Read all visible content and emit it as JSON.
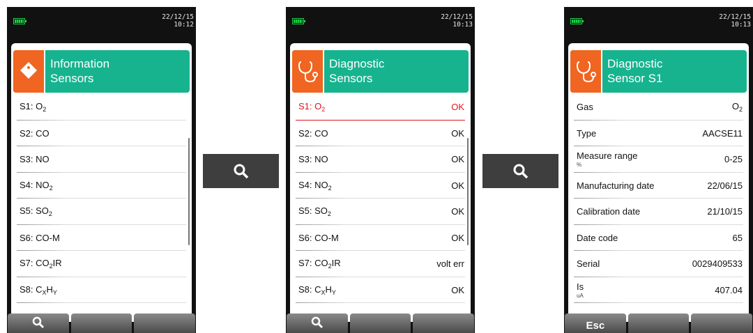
{
  "screens": [
    {
      "time_date": "22/12/15",
      "time_clock": "10:12",
      "header_line1": "Information",
      "header_line2": "Sensors",
      "header_icon": "tag-icon",
      "rows": [
        {
          "label": "S1: O<sub>2</sub>",
          "value": ""
        },
        {
          "label": "S2: CO",
          "value": ""
        },
        {
          "label": "S3: NO",
          "value": ""
        },
        {
          "label": "S4: NO<sub>2</sub>",
          "value": ""
        },
        {
          "label": "S5: SO<sub>2</sub>",
          "value": ""
        },
        {
          "label": "S6: CO-M",
          "value": ""
        },
        {
          "label": "S7: CO<sub>2</sub>IR",
          "value": ""
        },
        {
          "label": "S8: C<sub>X</sub>H<sub>Y</sub>",
          "value": ""
        }
      ],
      "softkeys": [
        "",
        "",
        ""
      ]
    },
    {
      "time_date": "22/12/15",
      "time_clock": "10:13",
      "header_line1": "Diagnostic",
      "header_line2": "Sensors",
      "header_icon": "stethoscope-icon",
      "rows": [
        {
          "label": "S1: O<sub>2</sub>",
          "value": "OK"
        },
        {
          "label": "S2: CO",
          "value": "OK"
        },
        {
          "label": "S3: NO",
          "value": "OK"
        },
        {
          "label": "S4: NO<sub>2</sub>",
          "value": "OK"
        },
        {
          "label": "S5: SO<sub>2</sub>",
          "value": "OK"
        },
        {
          "label": "S6: CO-M",
          "value": "OK"
        },
        {
          "label": "S7: CO<sub>2</sub>IR",
          "value": "volt err"
        },
        {
          "label": "S8: C<sub>X</sub>H<sub>Y</sub>",
          "value": "OK"
        }
      ],
      "softkeys": [
        "",
        "",
        ""
      ]
    },
    {
      "time_date": "22/12/15",
      "time_clock": "10:13",
      "header_line1": "Diagnostic",
      "header_line2": "Sensor S1",
      "header_icon": "stethoscope-icon",
      "rows": [
        {
          "label": "Gas",
          "value": "O<sub>2</sub>",
          "unit": ""
        },
        {
          "label": "Type",
          "value": "AACSE11",
          "unit": ""
        },
        {
          "label": "Measure range",
          "value": "0-25",
          "unit": "%"
        },
        {
          "label": "Manufacturing date",
          "value": "22/06/15",
          "unit": ""
        },
        {
          "label": "Calibration date",
          "value": "21/10/15",
          "unit": ""
        },
        {
          "label": "Date code",
          "value": "65",
          "unit": ""
        },
        {
          "label": "Serial",
          "value": "0029409533",
          "unit": ""
        },
        {
          "label": "Is",
          "value": "407.04",
          "unit": "uA"
        }
      ],
      "softkeys": [
        "Esc",
        "",
        ""
      ]
    }
  ],
  "nav_buttons": [
    "magnifier-icon",
    "magnifier-icon"
  ],
  "colors": {
    "header_teal": "#17b38f",
    "icon_orange": "#ef6521",
    "selected_red": "#e0141e",
    "battery_green": "#1fd14c"
  }
}
